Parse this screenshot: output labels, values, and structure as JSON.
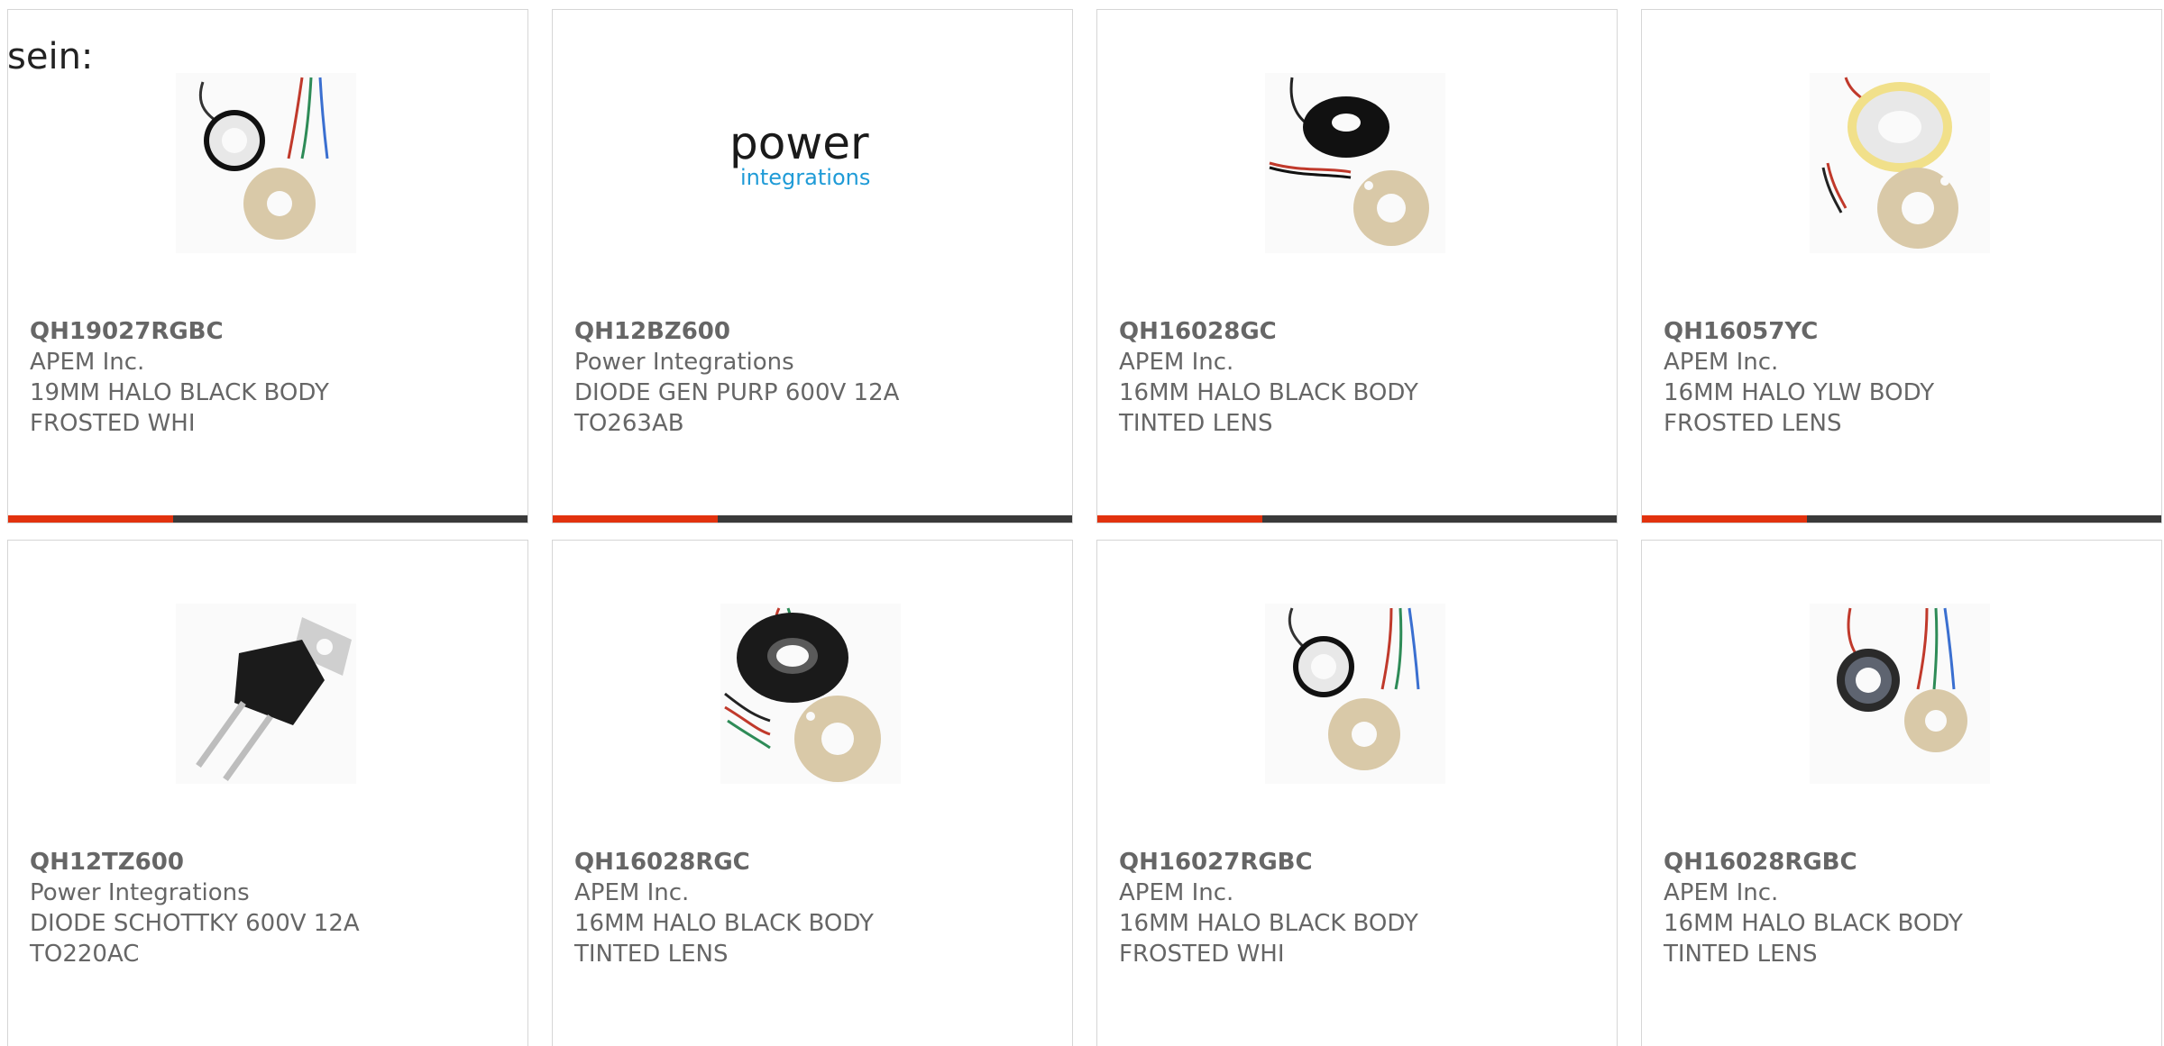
{
  "intro_text": "sein:",
  "colors": {
    "accent": "#e2320e",
    "bar": "#3a3a3a",
    "text": "#666666",
    "border": "#d6d6d6"
  },
  "products": [
    {
      "part": "QH19027RGBC",
      "maker": "APEM Inc.",
      "desc1": "19MM HALO BLACK BODY",
      "desc2": "FROSTED WHI",
      "image": "led-ring-white-icon"
    },
    {
      "part": "QH12BZ600",
      "maker": "Power Integrations",
      "desc1": "DIODE GEN PURP 600V 12A",
      "desc2": "TO263AB",
      "image": "power-integrations-logo",
      "logo_word": "power",
      "logo_sub": "integrations"
    },
    {
      "part": "QH16028GC",
      "maker": "APEM Inc.",
      "desc1": "16MM HALO BLACK BODY",
      "desc2": "TINTED LENS",
      "image": "led-ring-black-icon"
    },
    {
      "part": "QH16057YC",
      "maker": "APEM Inc.",
      "desc1": "16MM HALO YLW BODY",
      "desc2": "FROSTED LENS",
      "image": "led-ring-yellow-icon"
    },
    {
      "part": "QH12TZ600",
      "maker": "Power Integrations",
      "desc1": "DIODE SCHOTTKY 600V 12A",
      "desc2": "TO220AC",
      "image": "to220-diode-icon"
    },
    {
      "part": "QH16028RGC",
      "maker": "APEM Inc.",
      "desc1": "16MM HALO BLACK BODY",
      "desc2": "TINTED LENS",
      "image": "led-ring-black-large-icon"
    },
    {
      "part": "QH16027RGBC",
      "maker": "APEM Inc.",
      "desc1": "16MM HALO BLACK BODY",
      "desc2": "FROSTED WHI",
      "image": "led-ring-white-icon"
    },
    {
      "part": "QH16028RGBC",
      "maker": "APEM Inc.",
      "desc1": "16MM HALO BLACK BODY",
      "desc2": "TINTED LENS",
      "image": "led-ring-gray-icon"
    }
  ]
}
